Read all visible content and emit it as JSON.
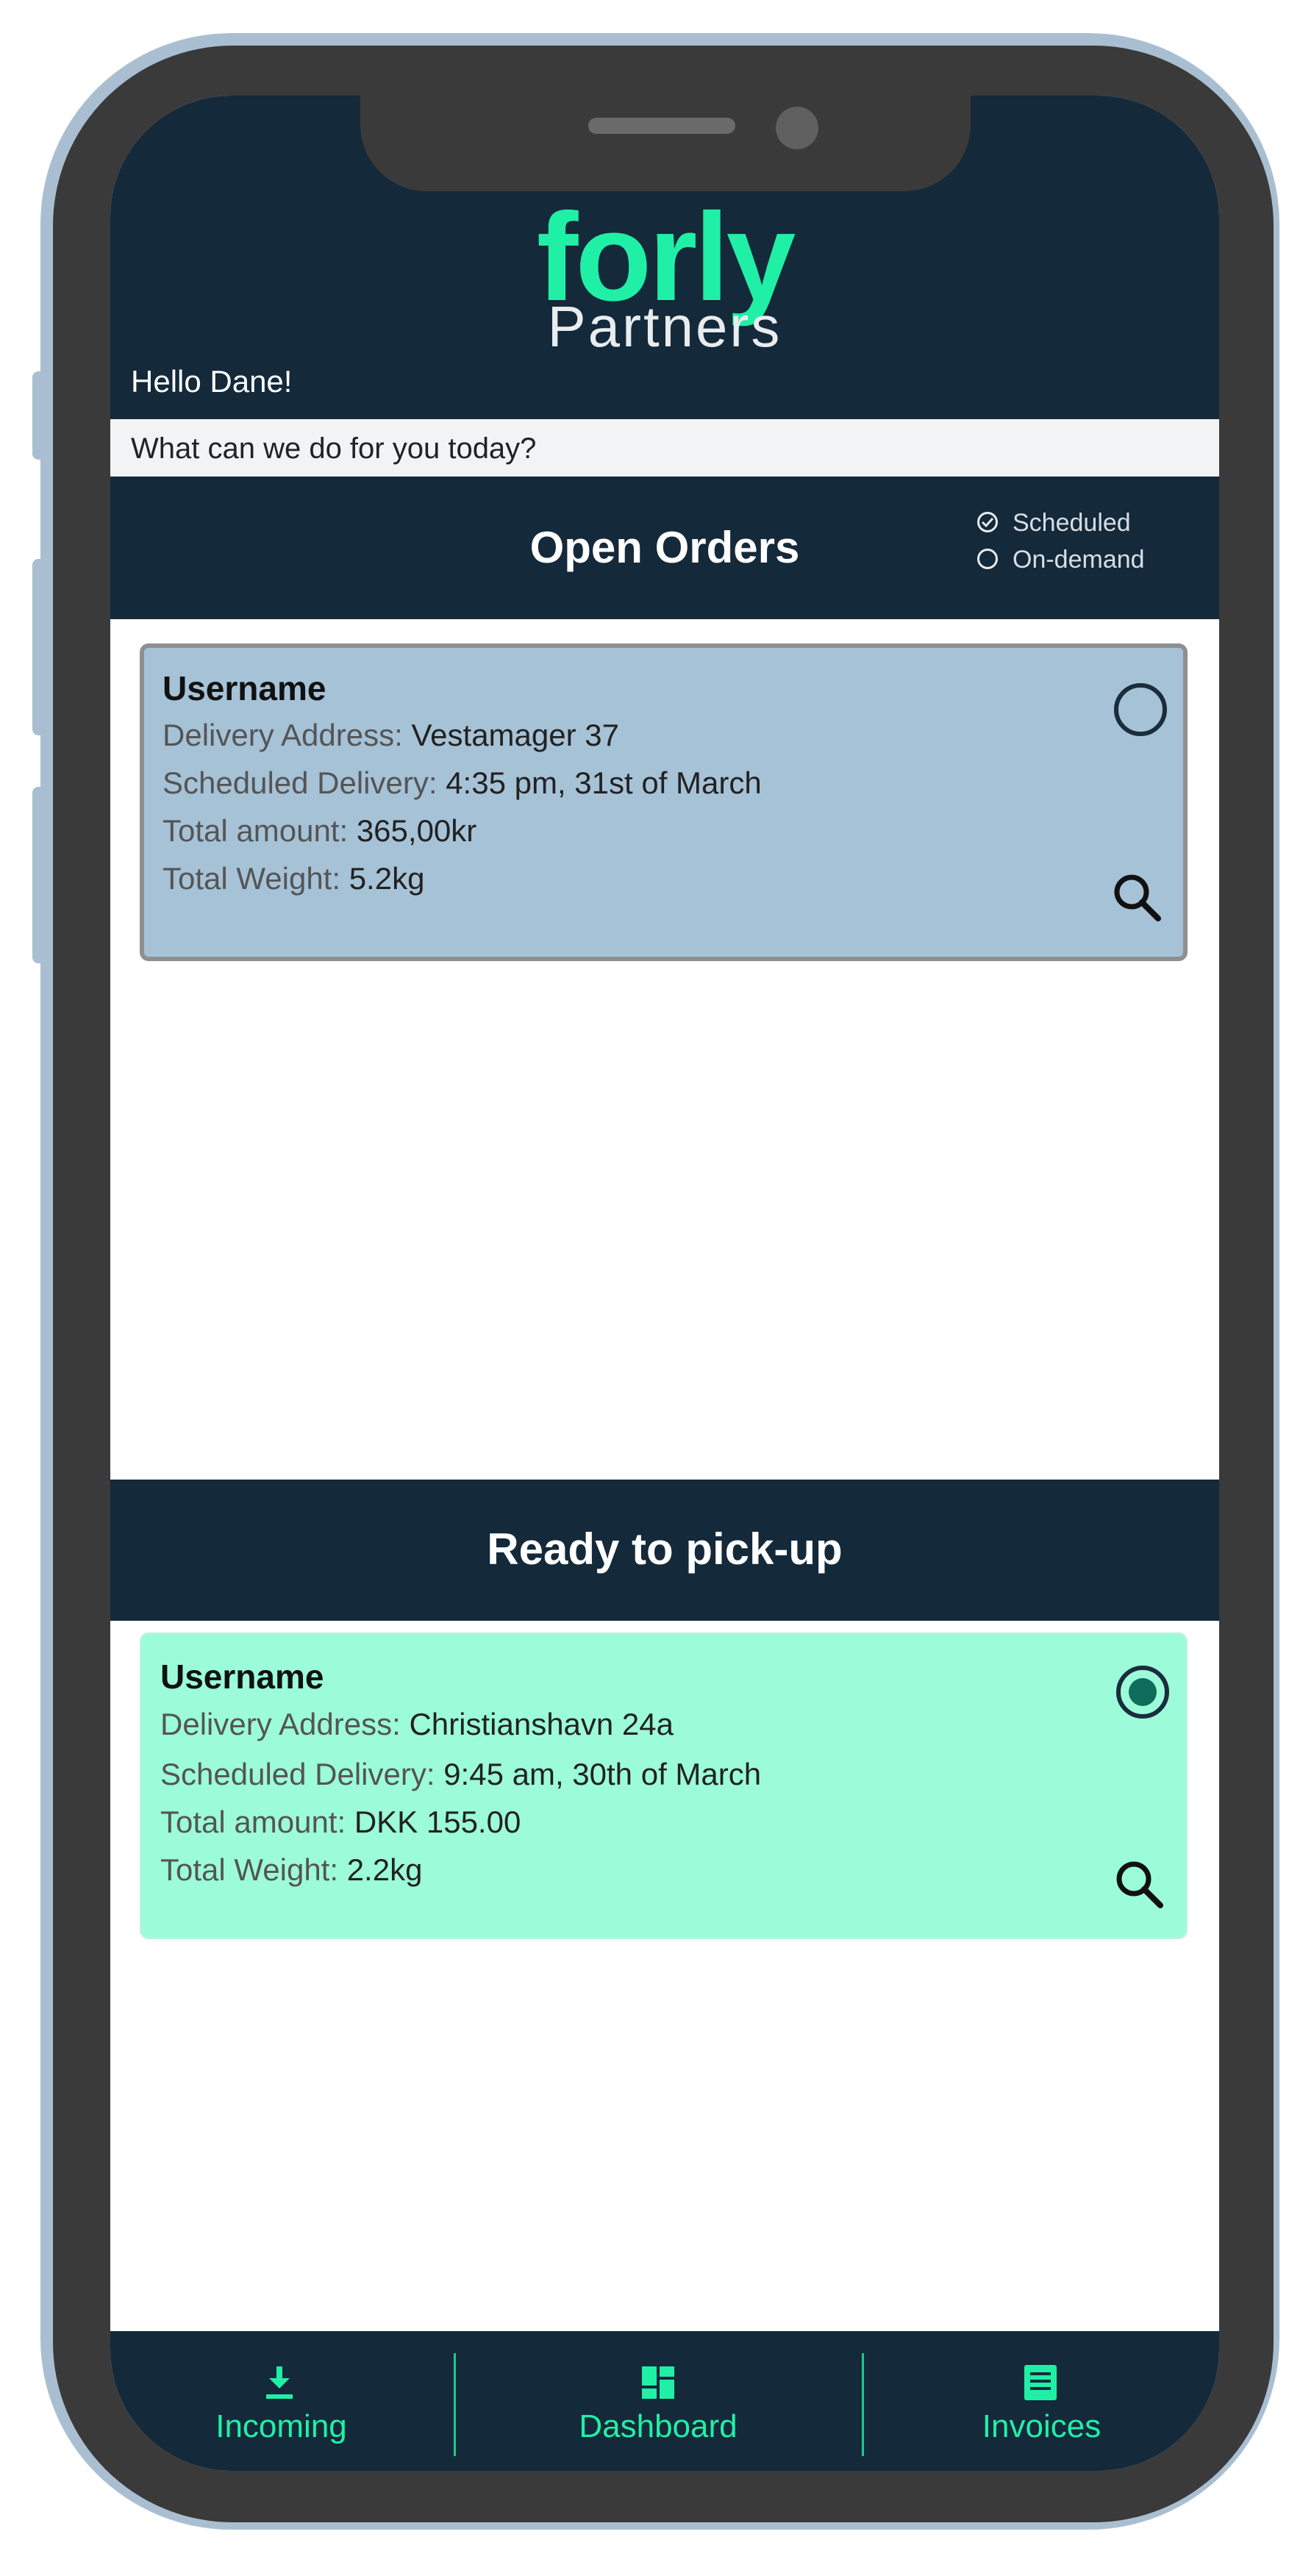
{
  "app": {
    "logo_main": "forly",
    "logo_sub": "Partners",
    "greeting": "Hello Dane!",
    "prompt": "What can we do for you today?"
  },
  "colors": {
    "header_bg": "#14293a",
    "brand_green": "#20f0a6",
    "open_card_bg": "#a6c2d7",
    "ready_card_bg": "#9cfcda"
  },
  "open_orders": {
    "title": "Open Orders",
    "filters": [
      {
        "label": "Scheduled",
        "checked": true
      },
      {
        "label": "On-demand",
        "checked": false
      }
    ],
    "order": {
      "username": "Username",
      "address_label": "Delivery Address:",
      "address": "Vestamager 37",
      "scheduled_label": "Scheduled Delivery:",
      "scheduled": "4:35 pm, 31st of March",
      "amount_label": "Total amount:",
      "amount": "365,00kr",
      "weight_label": "Total Weight:",
      "weight": "5.2kg",
      "selected": false
    }
  },
  "ready_pickup": {
    "title": "Ready to pick-up",
    "order": {
      "username": "Username",
      "address_label": "Delivery Address:",
      "address": "Christianshavn 24a",
      "scheduled_label": "Scheduled Delivery:",
      "scheduled": "9:45 am, 30th of March",
      "amount_label": "Total amount:",
      "amount": "DKK 155.00",
      "weight_label": "Total Weight:",
      "weight": "2.2kg",
      "selected": true
    }
  },
  "nav": {
    "incoming": {
      "label": "Incoming",
      "icon": "download-icon"
    },
    "dashboard": {
      "label": "Dashboard",
      "icon": "dashboard-icon"
    },
    "invoices": {
      "label": "Invoices",
      "icon": "invoice-icon"
    }
  }
}
